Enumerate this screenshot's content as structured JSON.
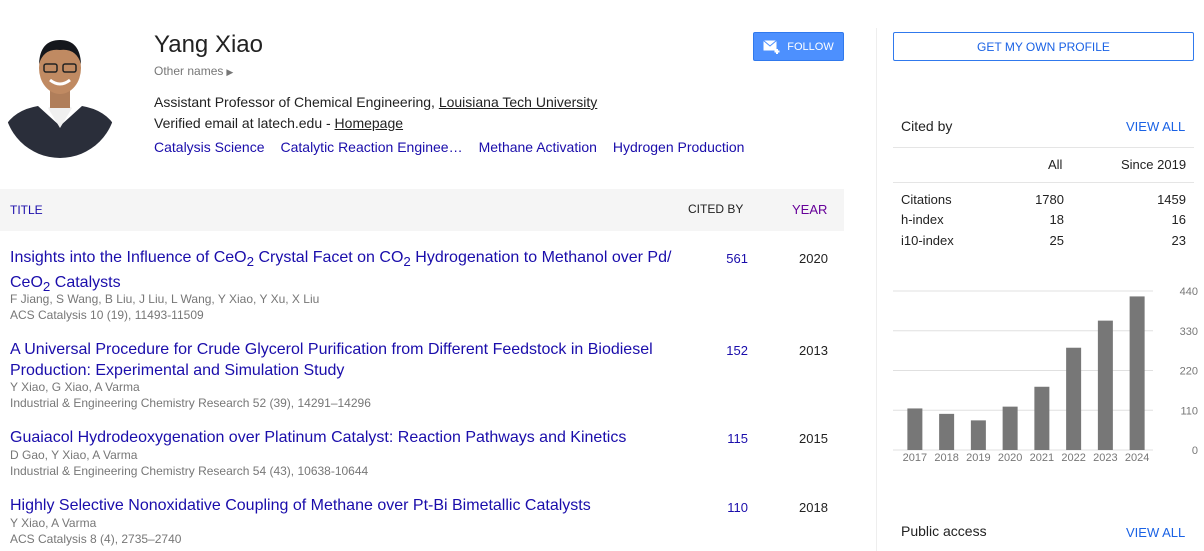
{
  "profile": {
    "name": "Yang Xiao",
    "other_names": "Other names",
    "affiliation_prefix": "Assistant Professor of Chemical Engineering, ",
    "affiliation_link": "Louisiana Tech University",
    "email_prefix": "Verified email at latech.edu - ",
    "homepage": "Homepage",
    "interests": [
      "Catalysis Science",
      "Catalytic Reaction Enginee…",
      "Methane Activation",
      "Hydrogen Production"
    ],
    "follow_label": "FOLLOW"
  },
  "table": {
    "header": {
      "title": "TITLE",
      "cited_by": "CITED BY",
      "year": "YEAR"
    },
    "rows": [
      {
        "title_html": "Insights into the Influence of CeO<sub>2</sub> Crystal Facet on CO<sub>2</sub> Hydrogenation to Methanol over Pd/ CeO<sub>2</sub> Catalysts",
        "authors": "F Jiang, S Wang, B Liu, J Liu, L Wang, Y Xiao, Y Xu, X Liu",
        "venue": "ACS Catalysis 10 (19), 11493-11509",
        "cited_by": "561",
        "year": "2020"
      },
      {
        "title_html": "A Universal Procedure for Crude Glycerol Purification from Different Feedstock in Biodiesel Production: Experimental and Simulation Study",
        "authors": "Y Xiao, G Xiao, A Varma",
        "venue": "Industrial & Engineering Chemistry Research 52 (39), 14291–14296",
        "cited_by": "152",
        "year": "2013"
      },
      {
        "title_html": "Guaiacol Hydrodeoxygenation over Platinum Catalyst: Reaction Pathways and Kinetics",
        "authors": "D Gao, Y Xiao, A Varma",
        "venue": "Industrial & Engineering Chemistry Research 54 (43), 10638-10644",
        "cited_by": "115",
        "year": "2015"
      },
      {
        "title_html": "Highly Selective Nonoxidative Coupling of Methane over Pt-Bi Bimetallic Catalysts",
        "authors": "Y Xiao, A Varma",
        "venue": "ACS Catalysis 8 (4), 2735–2740",
        "cited_by": "110",
        "year": "2018"
      }
    ]
  },
  "sidebar": {
    "own_profile_label": "GET MY OWN PROFILE",
    "cited_by_heading": "Cited by",
    "view_all": "VIEW ALL",
    "stats_header": {
      "all": "All",
      "since": "Since 2019"
    },
    "stats": [
      {
        "label": "Citations",
        "all": "1780",
        "since": "1459"
      },
      {
        "label": "h-index",
        "all": "18",
        "since": "16"
      },
      {
        "label": "i10-index",
        "all": "25",
        "since": "23"
      }
    ],
    "public_access": "Public access",
    "public_view_all": "VIEW ALL"
  },
  "chart_data": {
    "type": "bar",
    "categories": [
      "2017",
      "2018",
      "2019",
      "2020",
      "2021",
      "2022",
      "2023",
      "2024"
    ],
    "values": [
      115,
      100,
      82,
      120,
      175,
      283,
      358,
      425
    ],
    "yticks": [
      "440",
      "330",
      "220",
      "110",
      "0"
    ],
    "ylim": [
      0,
      440
    ],
    "grid": true,
    "bar_color": "#777777"
  }
}
